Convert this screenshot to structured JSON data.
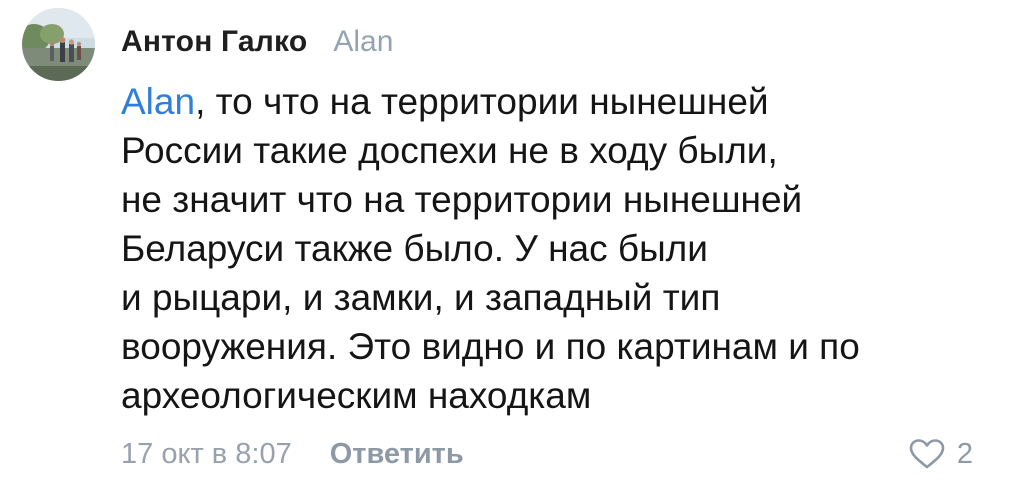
{
  "comment": {
    "author": "Антон Галко",
    "reply_to": "Alan",
    "mention": "Alan",
    "text_lines": [
      ", то что на территории нынешней",
      "России такие доспехи не в ходу были,",
      "не значит что на территории нынешней",
      "Беларуси также было. У нас были",
      "и рыцари, и замки, и западный тип",
      "вооружения. Это видно и по картинам и по",
      "археологическим находкам"
    ],
    "timestamp": "17 окт в 8:07",
    "reply_label": "Ответить",
    "likes": "2",
    "like_icon": "heart-outline-icon"
  },
  "colors": {
    "mention": "#2f7fd6",
    "muted": "#93a3b5",
    "text": "#151515"
  }
}
